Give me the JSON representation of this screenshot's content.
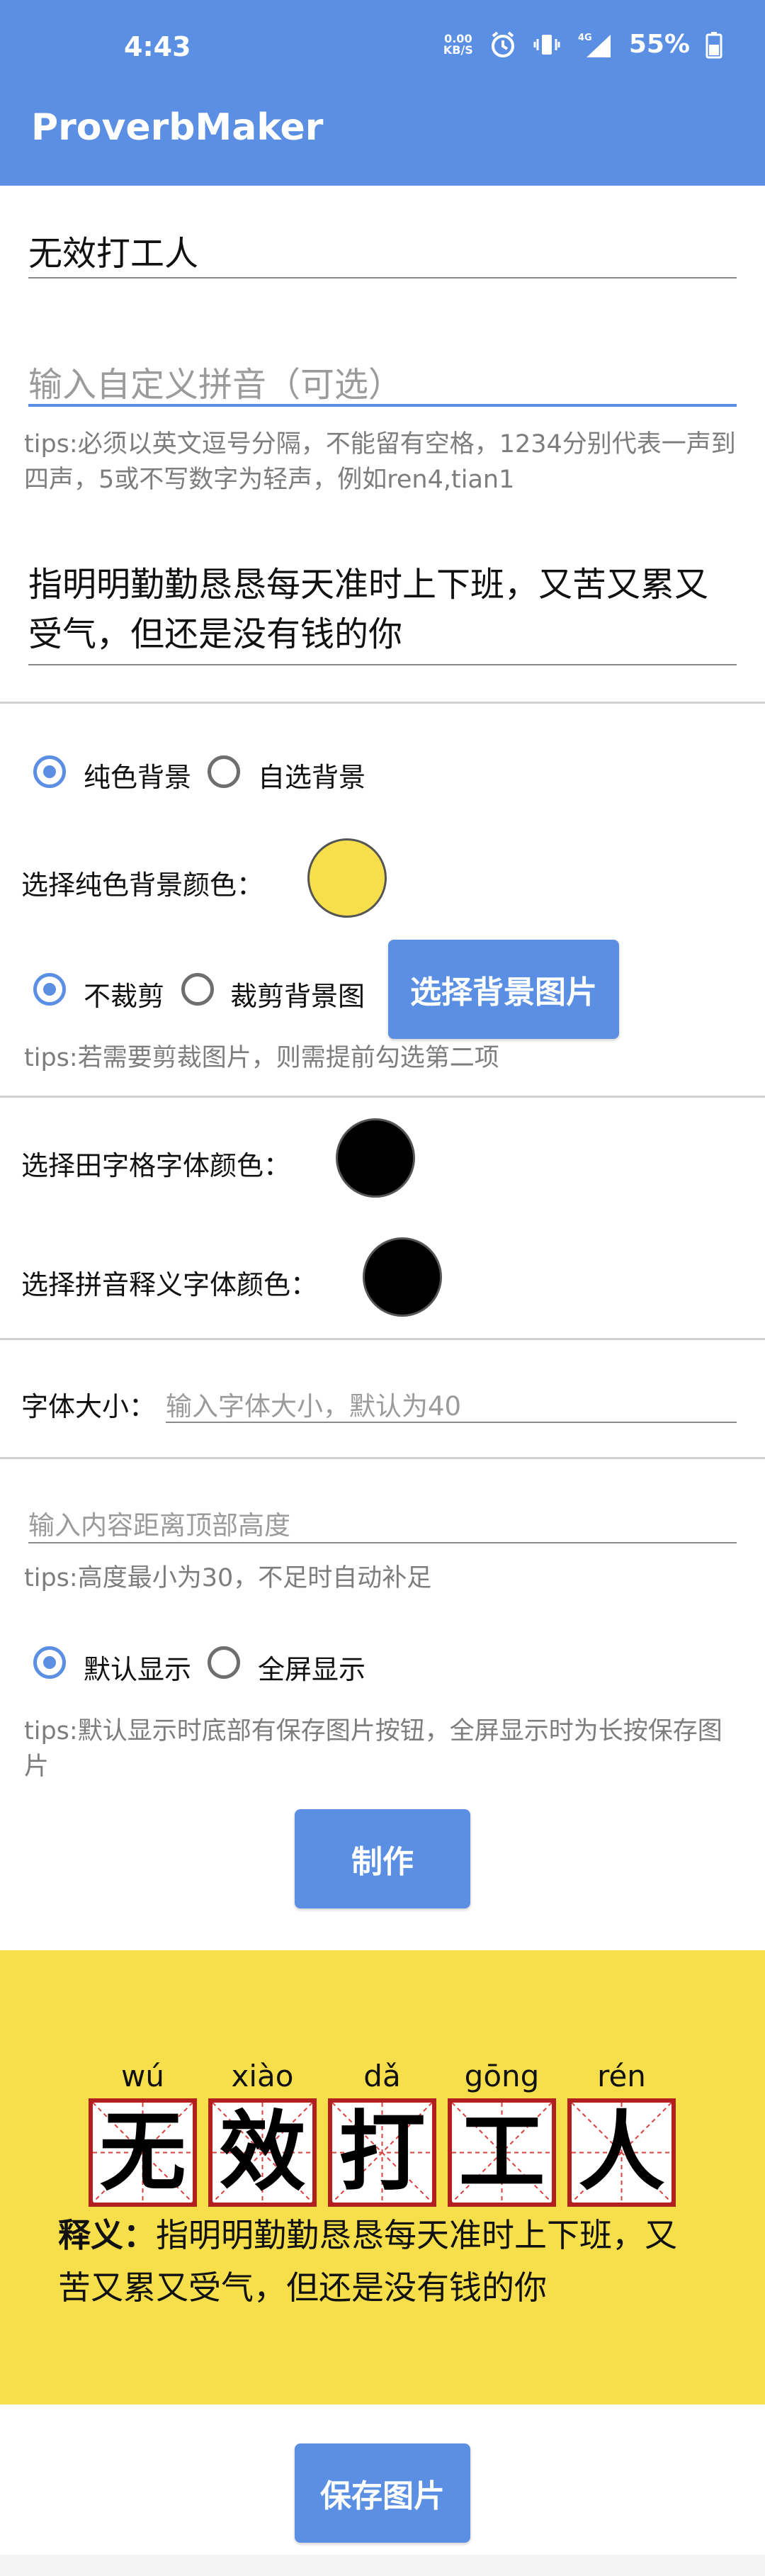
{
  "status_bar": {
    "time": "4:43",
    "net_speed": "0.00",
    "net_unit": "KB/S",
    "signal": "4G",
    "battery": "55%"
  },
  "app": {
    "title": "ProverbMaker"
  },
  "inputs": {
    "title_value": "无效打工人",
    "pinyin_placeholder": "输入自定义拼音（可选）",
    "pinyin_tips": "tips:必须以英文逗号分隔，不能留有空格，1234分别代表一声到四声，5或不写数字为轻声，例如ren4,tian1",
    "meaning_value": "指明明勤勤恳恳每天准时上下班，又苦又累又受气，但还是没有钱的你"
  },
  "background": {
    "option_solid": "纯色背景",
    "option_custom": "自选背景",
    "solid_color_label": "选择纯色背景颜色：",
    "solid_color": "#f6df4b",
    "crop_no": "不裁剪",
    "crop_yes": "裁剪背景图",
    "choose_image_button": "选择背景图片",
    "crop_tips": "tips:若需要剪裁图片，则需提前勾选第二项"
  },
  "fonts": {
    "grid_color_label": "选择田字格字体颜色：",
    "grid_color": "#000000",
    "pinyin_color_label": "选择拼音释义字体颜色：",
    "pinyin_color": "#000000",
    "size_label": "字体大小：",
    "size_placeholder": "输入字体大小，默认为40"
  },
  "layout": {
    "top_placeholder": "输入内容距离顶部高度",
    "top_tips": "tips:高度最小为30，不足时自动补足",
    "display_default": "默认显示",
    "display_fullscreen": "全屏显示",
    "display_tips": "tips:默认显示时底部有保存图片按钮，全屏显示时为长按保存图片"
  },
  "actions": {
    "make_button": "制作",
    "save_button": "保存图片"
  },
  "preview": {
    "chars": [
      {
        "hanzi": "无",
        "pinyin": "wú"
      },
      {
        "hanzi": "效",
        "pinyin": "xiào"
      },
      {
        "hanzi": "打",
        "pinyin": "dǎ"
      },
      {
        "hanzi": "工",
        "pinyin": "gōng"
      },
      {
        "hanzi": "人",
        "pinyin": "rén"
      }
    ],
    "meaning_label": "释义：",
    "meaning_text": "指明明勤勤恳恳每天准时上下班，又苦又累又受气，但还是没有钱的你"
  },
  "colors": {
    "accent": "#5b8fe3",
    "grid_border": "#b21f1f",
    "grid_guides": "#d94040"
  }
}
